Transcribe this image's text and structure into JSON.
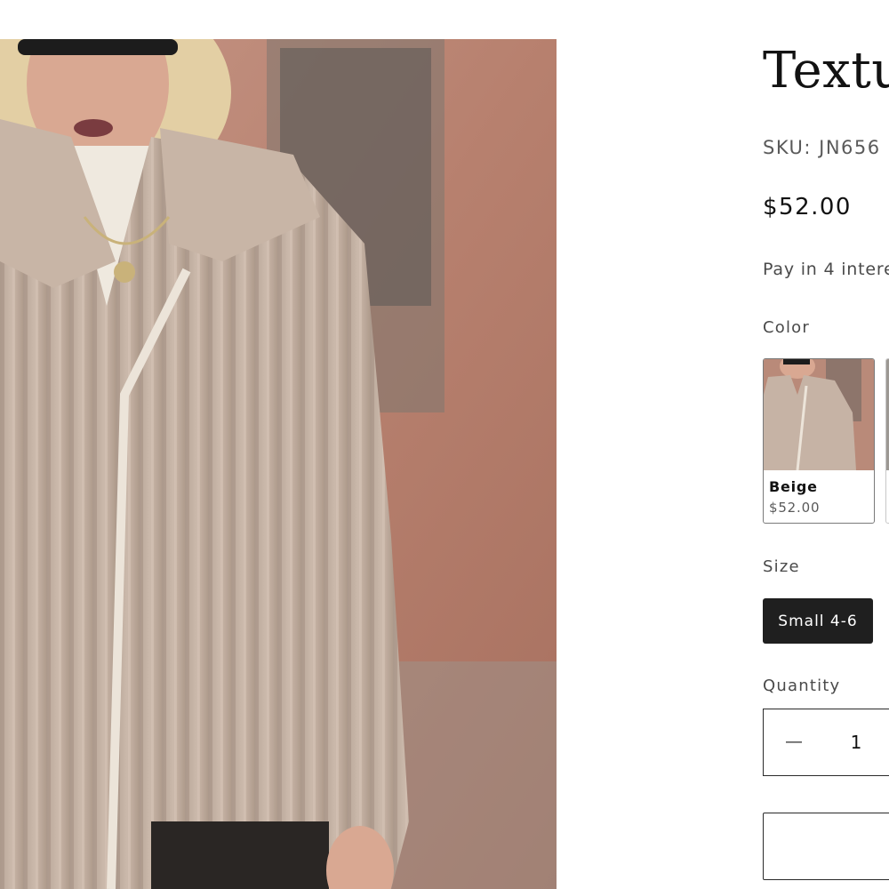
{
  "product": {
    "title": "Textu",
    "sku": "SKU: JN656",
    "price": "$52.00",
    "installments": "Pay in 4 intere",
    "image_icon": "product-photo-fur-jacket"
  },
  "color": {
    "label": "Color",
    "swatches": [
      {
        "name": "Beige",
        "price": "$52.00",
        "selected": true
      },
      {
        "name": "",
        "price": "",
        "selected": false
      }
    ]
  },
  "size": {
    "label": "Size",
    "options": [
      {
        "label": "Small 4-6",
        "selected": true
      }
    ]
  },
  "quantity": {
    "label": "Quantity",
    "value": "1",
    "minus_icon": "minus-icon"
  },
  "colors": {
    "text": "#121212",
    "muted": "#5a5a5a",
    "selected_size_bg": "#1f1f1f",
    "border": "#2a2a2a"
  }
}
